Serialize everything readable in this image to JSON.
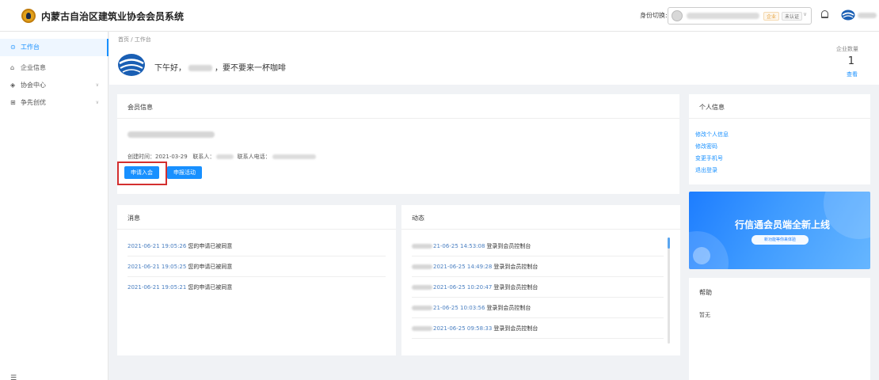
{
  "header": {
    "app_title": "内蒙古自治区建筑业协会会员系统",
    "identity_switch_label": "身份切换:",
    "tag_enterprise": "企业",
    "tag_auth": "未认证"
  },
  "sidebar": {
    "items": [
      {
        "label": "工作台",
        "icon": "home-icon",
        "active": true
      },
      {
        "label": "企业信息",
        "icon": "building-icon"
      },
      {
        "label": "协会中心",
        "icon": "diamond-icon",
        "expandable": true
      },
      {
        "label": "争先创优",
        "icon": "grid-icon",
        "expandable": true
      }
    ]
  },
  "breadcrumb": "首页 / 工作台",
  "welcome": {
    "greeting_prefix": "下午好，",
    "greeting_suffix": "，要不要来一杯咖啡",
    "enterprise_label": "企业数量",
    "enterprise_count": "1",
    "view_link": "查看"
  },
  "member_info": {
    "title": "会员信息",
    "created_label": "创建时间：",
    "created_date": "2021-03-29",
    "contact_label": "联系人：",
    "contact_phone_label": "联系人电话：",
    "apply_button": "申请入会",
    "report_button": "申报活动"
  },
  "messages": {
    "title": "消息",
    "items": [
      {
        "time": "2021-06-21 19:05:26",
        "text": "您的申请已被同意"
      },
      {
        "time": "2021-06-21 19:05:25",
        "text": "您的申请已被同意"
      },
      {
        "time": "2021-06-21 19:05:21",
        "text": "您的申请已被同意"
      }
    ]
  },
  "activity": {
    "title": "动态",
    "items": [
      {
        "time": "21-06-25 14:53:08",
        "text": "登录到会员控制台"
      },
      {
        "time": "2021-06-25 14:49:28",
        "text": "登录到会员控制台"
      },
      {
        "time": "2021-06-25 10:20:47",
        "text": "登录到会员控制台"
      },
      {
        "time": "21-06-25 10:03:56",
        "text": "登录到会员控制台"
      },
      {
        "time": "2021-06-25 09:58:33",
        "text": "登录到会员控制台"
      }
    ]
  },
  "profile": {
    "title": "个人信息",
    "links": [
      "修改个人信息",
      "修改密码",
      "变更手机号",
      "退出登录"
    ]
  },
  "banner": {
    "title": "行信通会员端全新上线",
    "button": "新功能等你来体验"
  },
  "help": {
    "title": "帮助",
    "text": "暂无"
  },
  "colors": {
    "accent": "#1890ff",
    "highlight": "#d32f2f"
  }
}
